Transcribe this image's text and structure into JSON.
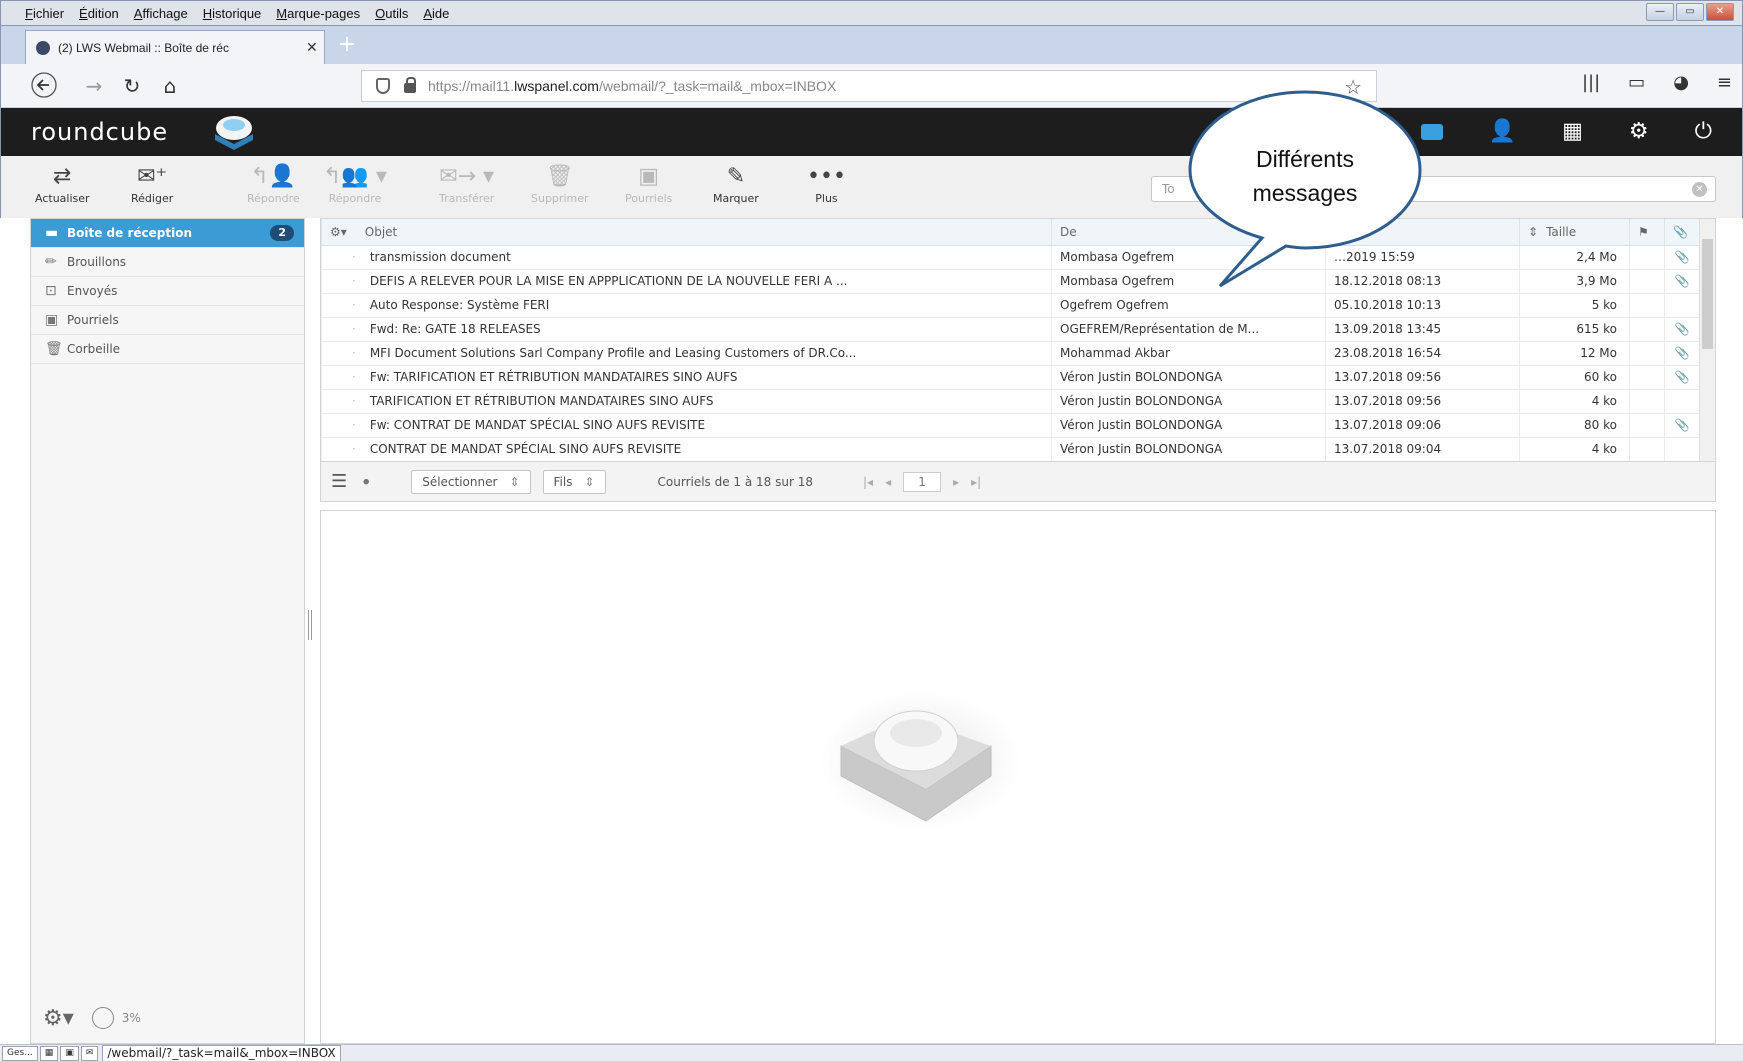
{
  "browser": {
    "menu": [
      "Fichier",
      "Édition",
      "Affichage",
      "Historique",
      "Marque-pages",
      "Outils",
      "Aide"
    ],
    "tab_title": "(2) LWS Webmail :: Boîte de réc",
    "url_prefix": "https://mail11.",
    "url_domain": "lwspanel.com",
    "url_suffix": "/webmail/?_task=mail&_mbox=INBOX"
  },
  "app": {
    "logo": "roundcube",
    "accent": "#3a9bd5"
  },
  "toolbar": {
    "refresh": "Actualiser",
    "compose": "Rédiger",
    "reply": "Répondre",
    "reply_all": "Répondre",
    "forward": "Transférer",
    "delete": "Supprimer",
    "spam": "Pourriels",
    "mark": "Marquer",
    "more": "Plus",
    "search_placeholder": "To"
  },
  "folders": [
    {
      "label": "Boîte de réception",
      "badge": "2",
      "icon": "inbox-icon"
    },
    {
      "label": "Brouillons",
      "icon": "pencil-icon"
    },
    {
      "label": "Envoyés",
      "icon": "sent-icon"
    },
    {
      "label": "Pourriels",
      "icon": "spam-icon"
    },
    {
      "label": "Corbeille",
      "icon": "trash-icon"
    }
  ],
  "quota": "3%",
  "columns": {
    "subject": "Objet",
    "from": "De",
    "size": "Taille"
  },
  "messages": [
    {
      "subject": "transmission document",
      "from": "Mombasa Ogefrem",
      "date": "…2019 15:59",
      "size": "2,4 Mo",
      "attachment": true
    },
    {
      "subject": "DEFIS A RELEVER POUR LA MISE EN APPPLICATIONN DE LA NOUVELLE FERI A ...",
      "from": "Mombasa Ogefrem",
      "date": "18.12.2018 08:13",
      "size": "3,9 Mo",
      "attachment": true
    },
    {
      "subject": "Auto Response: Système FERI",
      "from": "Ogefrem Ogefrem",
      "date": "05.10.2018 10:13",
      "size": "5 ko",
      "attachment": false
    },
    {
      "subject": "Fwd: Re: GATE 18 RELEASES",
      "from": "OGEFREM/Représentation de M...",
      "date": "13.09.2018 13:45",
      "size": "615 ko",
      "attachment": true
    },
    {
      "subject": "MFI Document Solutions Sarl Company Profile and Leasing Customers of DR.Co...",
      "from": "Mohammad Akbar",
      "date": "23.08.2018 16:54",
      "size": "12 Mo",
      "attachment": true
    },
    {
      "subject": "Fw: TARIFICATION ET RÉTRIBUTION MANDATAIRES SINO AUFS",
      "from": "Véron Justin BOLONDONGA",
      "date": "13.07.2018 09:56",
      "size": "60 ko",
      "attachment": true
    },
    {
      "subject": "TARIFICATION ET RÉTRIBUTION MANDATAIRES SINO AUFS",
      "from": "Véron Justin BOLONDONGA",
      "date": "13.07.2018 09:56",
      "size": "4 ko",
      "attachment": false
    },
    {
      "subject": "Fw: CONTRAT DE MANDAT SPÉCIAL SINO AUFS REVISITE",
      "from": "Véron Justin BOLONDONGA",
      "date": "13.07.2018 09:06",
      "size": "80 ko",
      "attachment": true
    },
    {
      "subject": "CONTRAT DE MANDAT SPÉCIAL SINO AUFS REVISITE",
      "from": "Véron Justin BOLONDONGA",
      "date": "13.07.2018 09:04",
      "size": "4 ko",
      "attachment": false
    }
  ],
  "listfooter": {
    "select": "Sélectionner",
    "threads": "Fils",
    "count": "Courriels de 1 à 18 sur 18",
    "page": "1"
  },
  "callout": {
    "line1": "Différents",
    "line2": "messages"
  },
  "statusbar": {
    "url": "/webmail/?_task=mail&_mbox=INBOX",
    "task_label": "Ges..."
  }
}
